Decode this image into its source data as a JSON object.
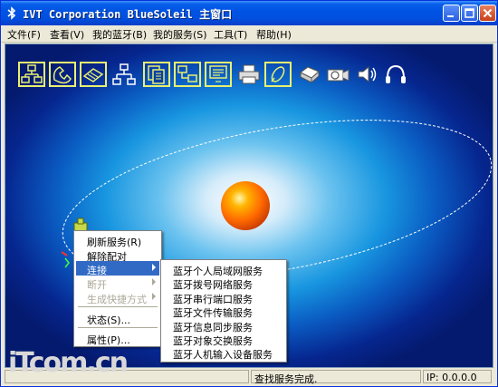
{
  "window": {
    "title": "IVT Corporation BlueSoleil 主窗口"
  },
  "menubar": {
    "items": [
      {
        "label": "文件(F)"
      },
      {
        "label": "查看(V)"
      },
      {
        "label": "我的蓝牙(B)"
      },
      {
        "label": "我的服务(S)"
      },
      {
        "label": "工具(T)"
      },
      {
        "label": "帮助(H)"
      }
    ]
  },
  "toolbar": {
    "icons": [
      "pan-service-icon",
      "dialup-service-icon",
      "fax-service-icon",
      "lan-service-icon",
      "file-transfer-icon",
      "network-access-icon",
      "serial-port-icon",
      "printer-icon",
      "sync-icon",
      "fax-machine-icon",
      "camera-icon",
      "audio-icon",
      "headset-icon"
    ]
  },
  "context_menu": {
    "items": [
      {
        "label": "刷新服务(R)",
        "state": "normal"
      },
      {
        "label": "解除配对",
        "state": "normal"
      },
      {
        "label": "连接",
        "state": "highlighted",
        "submenu": true
      },
      {
        "label": "断开",
        "state": "disabled",
        "submenu": true
      },
      {
        "label": "生成快捷方式",
        "state": "disabled",
        "submenu": true
      },
      {
        "label": "状态(S)...",
        "state": "normal"
      },
      {
        "label": "属性(P)...",
        "state": "normal"
      }
    ]
  },
  "submenu": {
    "items": [
      {
        "label": "蓝牙个人局域网服务"
      },
      {
        "label": "蓝牙拨号网络服务"
      },
      {
        "label": "蓝牙串行端口服务"
      },
      {
        "label": "蓝牙文件传输服务"
      },
      {
        "label": "蓝牙信息同步服务"
      },
      {
        "label": "蓝牙对象交换服务"
      },
      {
        "label": "蓝牙人机输入设备服务"
      }
    ]
  },
  "statusbar": {
    "message": "查找服务完成.",
    "ip": "IP: 0.0.0.0"
  },
  "watermark": {
    "text": "iTcom.cn"
  },
  "colors": {
    "title_blue": "#0054e3",
    "highlight": "#316ac5",
    "sphere_orange": "#ff6a00",
    "icon_yellow": "#e8f070"
  }
}
